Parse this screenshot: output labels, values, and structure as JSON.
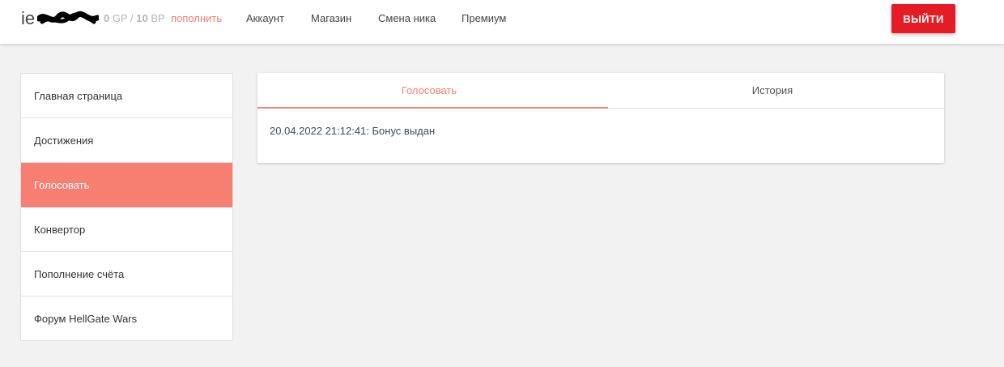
{
  "header": {
    "username_visible": "ie",
    "balance": {
      "gp_value": "0",
      "gp_unit": "GP",
      "separator": "/",
      "bp_value": "10",
      "bp_unit": "BP",
      "topup_label": "пополнить"
    },
    "nav": [
      "Аккаунт",
      "Магазин",
      "Смена ника",
      "Премиум"
    ],
    "logout_label": "ВЫЙТИ"
  },
  "sidebar": {
    "items": [
      {
        "label": "Главная страница"
      },
      {
        "label": "Достижения"
      },
      {
        "label": "Голосовать",
        "active": true
      },
      {
        "label": "Конвертор"
      },
      {
        "label": "Пополнение счёта"
      },
      {
        "label": "Форум HellGate Wars"
      }
    ]
  },
  "main": {
    "tabs": [
      {
        "label": "Голосовать",
        "active": true
      },
      {
        "label": "История"
      }
    ],
    "entries": [
      "20.04.2022 21:12:41: Бонус выдан"
    ]
  },
  "colors": {
    "accent": "#f77f71",
    "logout": "#e51c23",
    "background": "#f2f2f2"
  }
}
